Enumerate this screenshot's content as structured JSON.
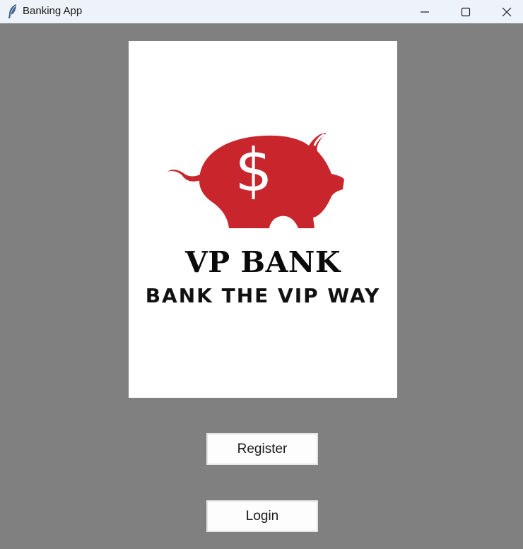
{
  "window": {
    "title": "Banking App",
    "app_icon": "feather-icon",
    "controls": [
      "minimize-icon",
      "maximize-icon",
      "close-icon"
    ]
  },
  "logo": {
    "brand_name": "VP BANK",
    "tagline": "BANK THE VIP WAY",
    "symbol": "$",
    "icon": "piggy-bank-icon",
    "accent_color": "#c8262c"
  },
  "buttons": {
    "register_label": "Register",
    "login_label": "Login"
  },
  "colors": {
    "background": "#808080",
    "titlebar": "#edf3f9",
    "card": "#ffffff"
  }
}
